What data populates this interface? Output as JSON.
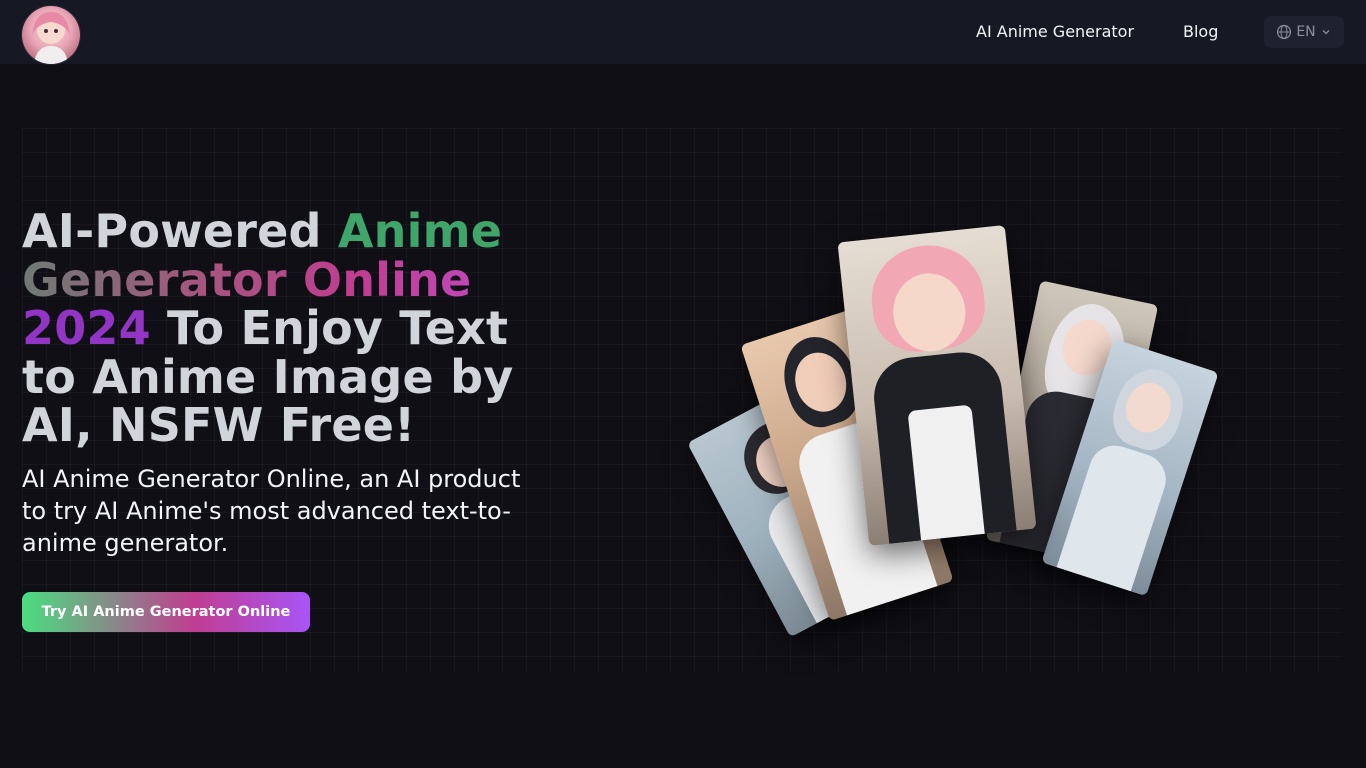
{
  "header": {
    "logo_icon": "avatar-logo-icon",
    "nav": [
      {
        "label": "AI Anime Generator"
      },
      {
        "label": "Blog"
      }
    ],
    "language": {
      "label": "EN",
      "icon": "globe-icon",
      "caret_icon": "chevron-down-icon"
    }
  },
  "hero": {
    "headline": {
      "part1": "AI-Powered ",
      "part2": "Anime",
      "part3": "Generator Online",
      "part4": "2024",
      "part5": " To Enjoy Text to Anime Image by AI, NSFW Free!"
    },
    "subtext": "AI Anime Generator Online, an AI product to try AI Anime's most advanced text-to-anime generator.",
    "cta_label": "Try AI Anime Generator Online"
  },
  "colors": {
    "background": "#0f0f15",
    "header": "#161823",
    "accent_green": "#3fa56a",
    "accent_pink": "#c03d91",
    "accent_purple": "#9234c4"
  },
  "images": [
    "anime-card-1",
    "anime-card-2",
    "anime-card-3",
    "anime-card-4",
    "anime-card-5"
  ]
}
